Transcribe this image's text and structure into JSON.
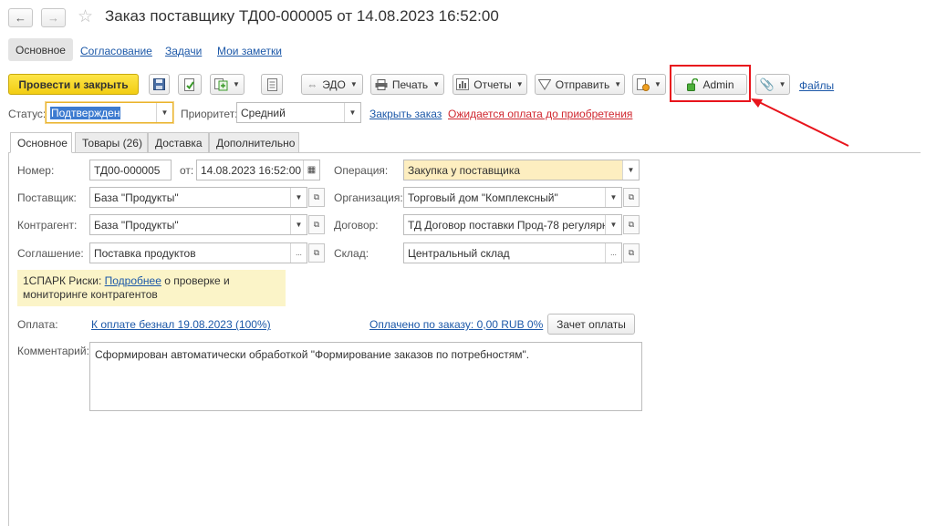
{
  "window": {
    "title": "Заказ поставщику ТД00-000005 от 14.08.2023 16:52:00",
    "back_icon": "arrow-left-icon",
    "forward_icon": "arrow-right-icon",
    "star_icon": "star-icon"
  },
  "topnav": {
    "items": [
      "Основное",
      "Согласование",
      "Задачи",
      "Мои заметки"
    ],
    "active": "Основное"
  },
  "toolbar": {
    "post_close": "Провести и закрыть",
    "edo": "ЭДО",
    "print": "Печать",
    "reports": "Отчеты",
    "send": "Отправить",
    "admin": "Admin",
    "files": "Файлы"
  },
  "status_bar": {
    "status_label": "Статус:",
    "status_value": "Подтвержден",
    "priority_label": "Приоритет:",
    "priority_value": "Средний",
    "close_order": "Закрыть заказ",
    "awaiting_payment": "Ожидается оплата до приобретения"
  },
  "tabs": [
    "Основное",
    "Товары (26)",
    "Доставка",
    "Дополнительно"
  ],
  "form": {
    "number_label": "Номер:",
    "number_value": "ТД00-000005",
    "from_label": "от:",
    "date_value": "14.08.2023 16:52:00",
    "operation_label": "Операция:",
    "operation_value": "Закупка у поставщика",
    "supplier_label": "Поставщик:",
    "supplier_value": "База \"Продукты\"",
    "organization_label": "Организация:",
    "organization_value": "Торговый дом \"Комплексный\"",
    "counterparty_label": "Контрагент:",
    "counterparty_value": "База \"Продукты\"",
    "contract_label": "Договор:",
    "contract_value": "ТД Договор поставки Прод-78 регулярны",
    "agreement_label": "Соглашение:",
    "agreement_value": "Поставка продуктов",
    "warehouse_label": "Склад:",
    "warehouse_value": "Центральный склад"
  },
  "spark": {
    "prefix": "1СПАРК Риски:",
    "link": "Подробнее",
    "suffix": "о проверке и",
    "line2": "мониторинге контрагентов"
  },
  "payment": {
    "label": "Оплата:",
    "link": "К оплате безнал 19.08.2023 (100%)",
    "paid_link": "Оплачено по заказу: 0,00 RUB 0%",
    "offset_button": "Зачет оплаты"
  },
  "comment": {
    "label": "Комментарий:",
    "text": "Сформирован автоматически обработкой \"Формирование заказов по потребностям\"."
  },
  "colors": {
    "primary_button": "#f5d31a",
    "link": "#1c58a8",
    "red_link": "#d0272f",
    "highlight_field": "#fdeec0",
    "annotation": "#e8141c",
    "spark_bg": "#fbf4c8"
  }
}
